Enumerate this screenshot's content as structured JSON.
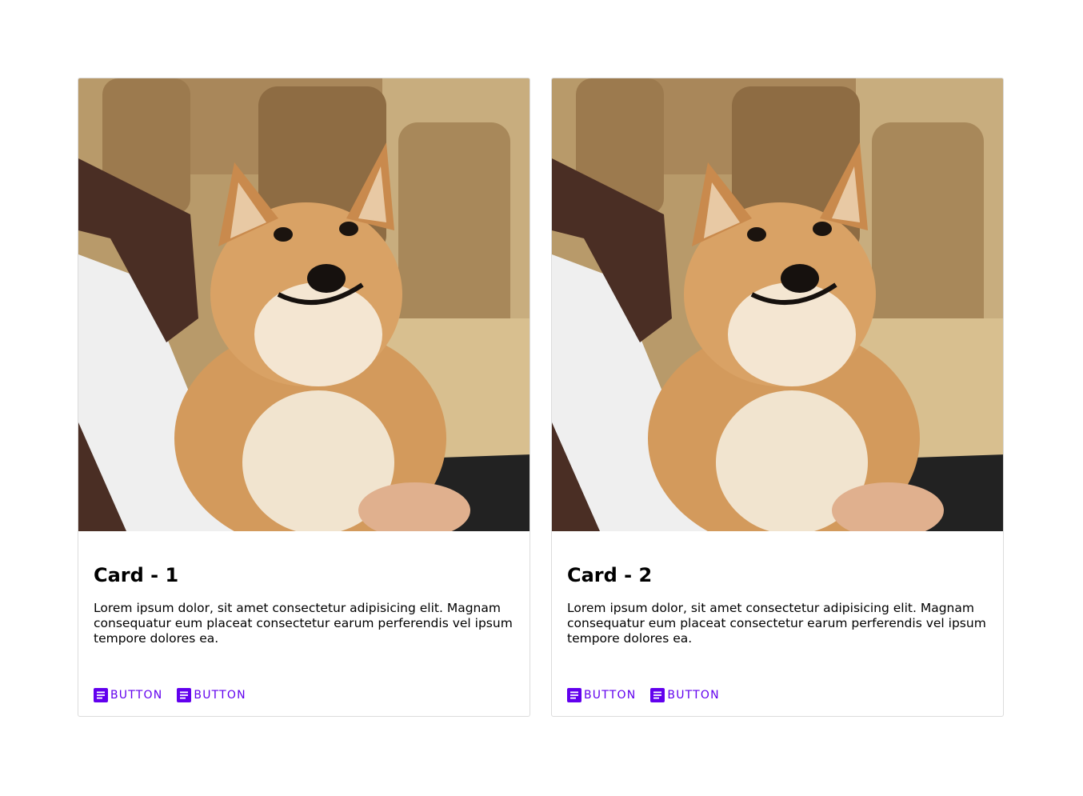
{
  "cards": [
    {
      "title": "Card - 1",
      "text": "Lorem ipsum dolor, sit amet consectetur adipisicing elit. Magnam consequatur eum placeat consectetur earum perferendis vel ipsum tempore dolores ea.",
      "image_icon": "shiba-inu-dog-photo",
      "buttons": [
        {
          "label": "BUTTON",
          "icon": "article-icon"
        },
        {
          "label": "BUTTON",
          "icon": "article-icon"
        }
      ]
    },
    {
      "title": "Card - 2",
      "text": "Lorem ipsum dolor, sit amet consectetur adipisicing elit. Magnam consequatur eum placeat consectetur earum perferendis vel ipsum tempore dolores ea.",
      "image_icon": "shiba-inu-dog-photo",
      "buttons": [
        {
          "label": "BUTTON",
          "icon": "article-icon"
        },
        {
          "label": "BUTTON",
          "icon": "article-icon"
        }
      ]
    }
  ],
  "colors": {
    "accent": "#6200ee",
    "border": "#dcdcdc"
  }
}
